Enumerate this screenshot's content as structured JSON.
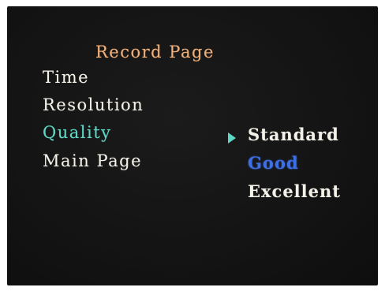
{
  "menu": {
    "title": "Record Page",
    "items": [
      {
        "label": "Time"
      },
      {
        "label": "Resolution"
      },
      {
        "label": "Quality",
        "selected": true
      },
      {
        "label": "Main Page"
      }
    ]
  },
  "quality_options": {
    "cursor_icon": "triangle-right-icon",
    "items": [
      {
        "label": "Standard",
        "current": true
      },
      {
        "label": "Good",
        "highlighted": true
      },
      {
        "label": "Excellent"
      }
    ]
  },
  "colors": {
    "title": "#f0b07a",
    "selected_item": "#5fd7c6",
    "highlighted_option": "#3d6fe6",
    "text": "#f4f1e8",
    "background": "#141414"
  }
}
